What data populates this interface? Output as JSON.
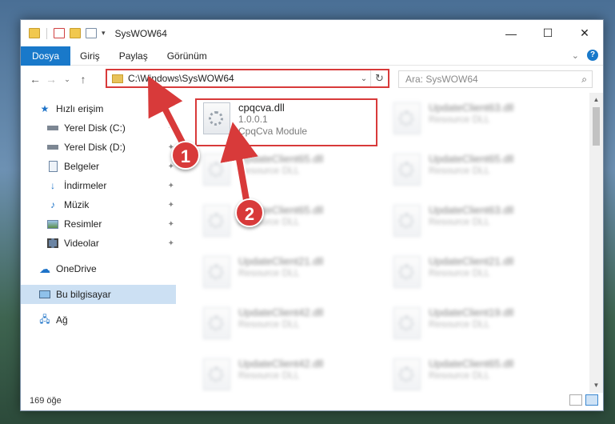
{
  "window": {
    "title": "SysWOW64"
  },
  "ribbon": {
    "tabs": [
      "Dosya",
      "Giriş",
      "Paylaş",
      "Görünüm"
    ]
  },
  "address": {
    "path": "C:\\Windows\\SysWOW64"
  },
  "search": {
    "placeholder": "Ara: SysWOW64"
  },
  "sidebar": {
    "items": [
      {
        "label": "Hızlı erişim",
        "icon": "star-icon"
      },
      {
        "label": "Yerel Disk (C:)",
        "icon": "drive-icon"
      },
      {
        "label": "Yerel Disk (D:)",
        "icon": "drive-icon"
      },
      {
        "label": "Belgeler",
        "icon": "documents-icon"
      },
      {
        "label": "İndirmeler",
        "icon": "download-icon"
      },
      {
        "label": "Müzik",
        "icon": "music-icon"
      },
      {
        "label": "Resimler",
        "icon": "pictures-icon"
      },
      {
        "label": "Videolar",
        "icon": "videos-icon"
      },
      {
        "label": "OneDrive",
        "icon": "cloud-icon"
      },
      {
        "label": "Bu bilgisayar",
        "icon": "computer-icon"
      },
      {
        "label": "Ağ",
        "icon": "network-icon"
      }
    ]
  },
  "files": {
    "main": {
      "name": "cpqcva.dll",
      "version": "1.0.0.1",
      "description": "CpqCva Module"
    },
    "blurred": [
      {
        "name": "UpdateClient63.dll",
        "sub": "Resource DLL"
      },
      {
        "name": "UpdateClient65.dll",
        "sub": "Resource DLL"
      },
      {
        "name": "UpdateClient65.dll",
        "sub": "Resource DLL"
      },
      {
        "name": "UpdateClient65.dll",
        "sub": "Resource DLL"
      },
      {
        "name": "UpdateClient63.dll",
        "sub": "Resource DLL"
      },
      {
        "name": "UpdateClient21.dll",
        "sub": "Resource DLL"
      },
      {
        "name": "UpdateClient21.dll",
        "sub": "Resource DLL"
      },
      {
        "name": "UpdateClient42.dll",
        "sub": "Resource DLL"
      },
      {
        "name": "UpdateClient19.dll",
        "sub": "Resource DLL"
      },
      {
        "name": "UpdateClient42.dll",
        "sub": "Resource DLL"
      },
      {
        "name": "UpdateClient65.dll",
        "sub": "Resource DLL"
      }
    ]
  },
  "status": {
    "count": "169 öğe"
  },
  "markers": [
    "1",
    "2"
  ],
  "colors": {
    "accent": "#1979ca",
    "annotation": "#d83a3a"
  }
}
